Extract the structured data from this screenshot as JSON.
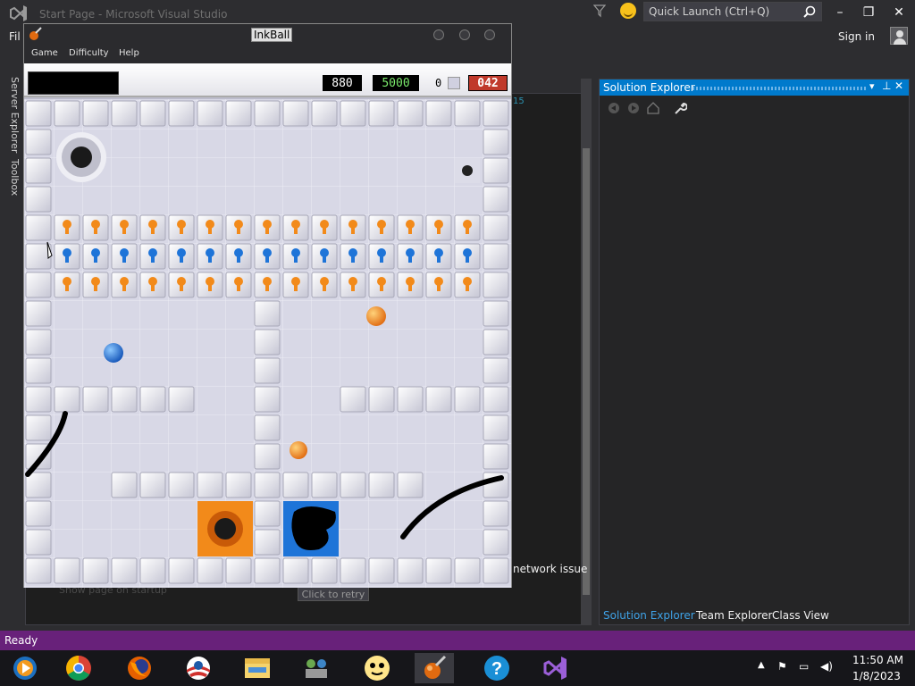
{
  "vs": {
    "title": "Start Page - Microsoft Visual Studio",
    "quick_launch_placeholder": "Quick Launch (Ctrl+Q)",
    "menu_file": "Fil",
    "sign_in": "Sign in",
    "rail": {
      "server_explorer": "Server Explorer",
      "toolbox": "Toolbox"
    },
    "editor": {
      "line_number": "15",
      "network_issue": "network issue",
      "retry_button": "Click to retry",
      "show_on_startup": "Show page on startup"
    },
    "solution_explorer": {
      "title": "Solution Explorer",
      "tabs": [
        "Solution Explorer",
        "Team Explorer",
        "Class View"
      ]
    },
    "status": "Ready",
    "accent": "#007acc",
    "status_color": "#68217a"
  },
  "taskbar": {
    "icons": [
      "windows-media-player-icon",
      "chrome-icon",
      "firefox-icon",
      "obama-icon",
      "file-explorer-icon",
      "network-people-icon",
      "smiley-face-icon",
      "inkball-icon",
      "help-icon",
      "visual-studio-icon"
    ],
    "active_index": 7,
    "clock": {
      "time": "11:50 AM",
      "date": "1/8/2023"
    }
  },
  "inkball": {
    "title": "InkBall",
    "menu": [
      "Game",
      "Difficulty",
      "Help"
    ],
    "score": "880",
    "target": "5000",
    "balls_remaining": "0",
    "time_left": "042",
    "colors": {
      "orange": "#f28a1a",
      "blue": "#1e74d8",
      "ink": "#000000",
      "tile": "#e8e8f2"
    }
  }
}
